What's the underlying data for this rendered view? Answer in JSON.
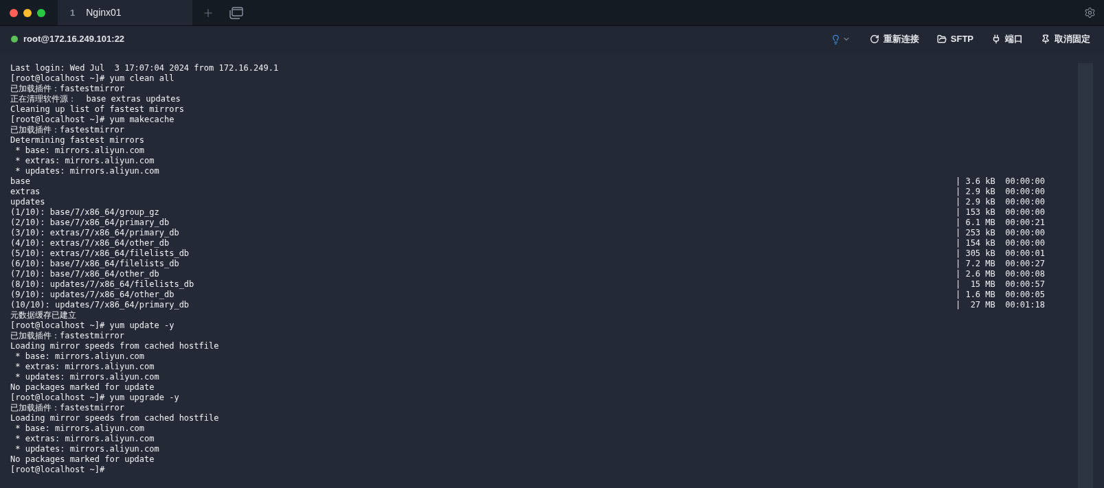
{
  "tabs": [
    {
      "number": "1",
      "label": "Nginx01",
      "selected": true
    }
  ],
  "connection": {
    "host": "root@172.16.249.101:22",
    "connected": true
  },
  "actions": [
    {
      "kind": "refresh",
      "label": "重新连接"
    },
    {
      "kind": "folder",
      "label": "SFTP"
    },
    {
      "kind": "plug",
      "label": "端口"
    },
    {
      "kind": "pin",
      "label": "取消固定"
    }
  ],
  "terminal": {
    "lines": [
      {
        "text": "Last login: Wed Jul  3 17:07:04 2024 from 172.16.249.1"
      },
      {
        "text": "[root@localhost ~]# yum clean all"
      },
      {
        "text": "已加载插件：fastestmirror"
      },
      {
        "text": "正在清理软件源：  base extras updates"
      },
      {
        "text": "Cleaning up list of fastest mirrors"
      },
      {
        "text": "[root@localhost ~]# yum makecache"
      },
      {
        "text": "已加载插件：fastestmirror"
      },
      {
        "text": "Determining fastest mirrors"
      },
      {
        "text": " * base: mirrors.aliyun.com"
      },
      {
        "text": " * extras: mirrors.aliyun.com"
      },
      {
        "text": " * updates: mirrors.aliyun.com"
      },
      {
        "text": "base",
        "stats": "| 3.6 kB  00:00:00"
      },
      {
        "text": "extras",
        "stats": "| 2.9 kB  00:00:00"
      },
      {
        "text": "updates",
        "stats": "| 2.9 kB  00:00:00"
      },
      {
        "text": "(1/10): base/7/x86_64/group_gz",
        "stats": "| 153 kB  00:00:00"
      },
      {
        "text": "(2/10): base/7/x86_64/primary_db",
        "stats": "| 6.1 MB  00:00:21"
      },
      {
        "text": "(3/10): extras/7/x86_64/primary_db",
        "stats": "| 253 kB  00:00:00"
      },
      {
        "text": "(4/10): extras/7/x86_64/other_db",
        "stats": "| 154 kB  00:00:00"
      },
      {
        "text": "(5/10): extras/7/x86_64/filelists_db",
        "stats": "| 305 kB  00:00:01"
      },
      {
        "text": "(6/10): base/7/x86_64/filelists_db",
        "stats": "| 7.2 MB  00:00:27"
      },
      {
        "text": "(7/10): base/7/x86_64/other_db",
        "stats": "| 2.6 MB  00:00:08"
      },
      {
        "text": "(8/10): updates/7/x86_64/filelists_db",
        "stats": "|  15 MB  00:00:57"
      },
      {
        "text": "(9/10): updates/7/x86_64/other_db",
        "stats": "| 1.6 MB  00:00:05"
      },
      {
        "text": "(10/10): updates/7/x86_64/primary_db",
        "stats": "|  27 MB  00:01:18"
      },
      {
        "text": "元数据缓存已建立"
      },
      {
        "text": "[root@localhost ~]# yum update -y"
      },
      {
        "text": "已加载插件：fastestmirror"
      },
      {
        "text": "Loading mirror speeds from cached hostfile"
      },
      {
        "text": " * base: mirrors.aliyun.com"
      },
      {
        "text": " * extras: mirrors.aliyun.com"
      },
      {
        "text": " * updates: mirrors.aliyun.com"
      },
      {
        "text": "No packages marked for update"
      },
      {
        "text": "[root@localhost ~]# yum upgrade -y"
      },
      {
        "text": "已加载插件：fastestmirror"
      },
      {
        "text": "Loading mirror speeds from cached hostfile"
      },
      {
        "text": " * base: mirrors.aliyun.com"
      },
      {
        "text": " * extras: mirrors.aliyun.com"
      },
      {
        "text": " * updates: mirrors.aliyun.com"
      },
      {
        "text": "No packages marked for update"
      },
      {
        "text": "[root@localhost ~]#"
      }
    ]
  }
}
